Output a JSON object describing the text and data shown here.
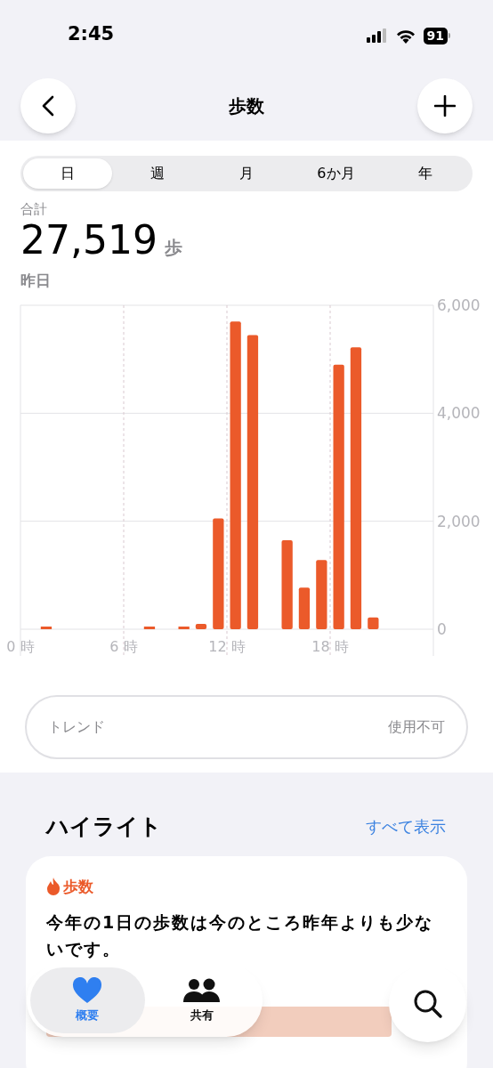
{
  "status_bar": {
    "time": "2:45",
    "battery": "91"
  },
  "nav": {
    "title": "歩数"
  },
  "periods": [
    {
      "label": "日",
      "selected": true
    },
    {
      "label": "週",
      "selected": false
    },
    {
      "label": "月",
      "selected": false
    },
    {
      "label": "6か月",
      "selected": false
    },
    {
      "label": "年",
      "selected": false
    }
  ],
  "summary": {
    "label": "合計",
    "value": "27,519",
    "unit": "歩",
    "date": "昨日"
  },
  "chart_data": {
    "type": "bar",
    "x": [
      0.5,
      1.5,
      2.5,
      3.5,
      4.5,
      5.5,
      6.5,
      7.5,
      8.5,
      9.5,
      10.5,
      11.5,
      12.5,
      13.5,
      14.5,
      15.5,
      16.5,
      17.5,
      18.5,
      19.5,
      20.5,
      21.5,
      22.5,
      23.5
    ],
    "xlim": [
      0,
      24
    ],
    "grid": true,
    "series": [
      {
        "color": "#eb5a2a",
        "values": [
          0,
          50,
          0,
          0,
          0,
          0,
          0,
          50,
          0,
          50,
          100,
          2050,
          5700,
          5450,
          0,
          1650,
          770,
          1280,
          4900,
          5220,
          220,
          0,
          0,
          0
        ]
      }
    ],
    "ylim": [
      0,
      6000
    ],
    "yticks": [
      {
        "value": 0,
        "label": "0"
      },
      {
        "value": 2000,
        "label": "2,000"
      },
      {
        "value": 4000,
        "label": "4,000"
      },
      {
        "value": 6000,
        "label": "6,000"
      }
    ],
    "xticks": [
      {
        "value": 0,
        "label": "0 時"
      },
      {
        "value": 6,
        "label": "6 時"
      },
      {
        "value": 12,
        "label": "12 時"
      },
      {
        "value": 18,
        "label": "18 時"
      }
    ]
  },
  "trend": {
    "label": "トレンド",
    "value": "使用不可"
  },
  "highlights": {
    "title": "ハイライト",
    "link": "すべて表示",
    "card": {
      "category": "歩数",
      "text": "今年の1日の歩数は今のところ昨年よりも少ないです。"
    }
  },
  "tab_bar": [
    {
      "label": "概要",
      "kind": "heart",
      "selected": true
    },
    {
      "label": "共有",
      "kind": "people",
      "selected": false
    }
  ]
}
